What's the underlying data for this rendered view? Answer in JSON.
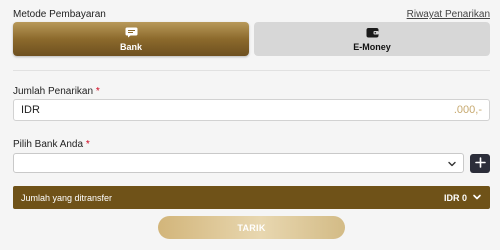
{
  "header": {
    "payment_method_label": "Metode Pembayaran",
    "history_link": "Riwayat Penarikan"
  },
  "payment_methods": [
    {
      "label": "Bank",
      "icon": "chat-card-icon",
      "selected": true
    },
    {
      "label": "E-Money",
      "icon": "wallet-icon",
      "selected": false
    }
  ],
  "withdraw_amount": {
    "label": "Jumlah Penarikan",
    "required_mark": "*",
    "currency": "IDR",
    "suffix": ".000,-"
  },
  "bank_select": {
    "label": "Pilih Bank Anda",
    "required_mark": "*",
    "value": ""
  },
  "transfer_summary": {
    "label": "Jumlah yang ditransfer",
    "amount": "IDR 0"
  },
  "submit": {
    "label": "TARIK"
  },
  "colors": {
    "accent_brown": "#6f5218",
    "gold_gradient_start": "#b8995a",
    "gold_text": "#c7a96f",
    "required": "#d0021b",
    "dark_button": "#2c2e3a"
  }
}
